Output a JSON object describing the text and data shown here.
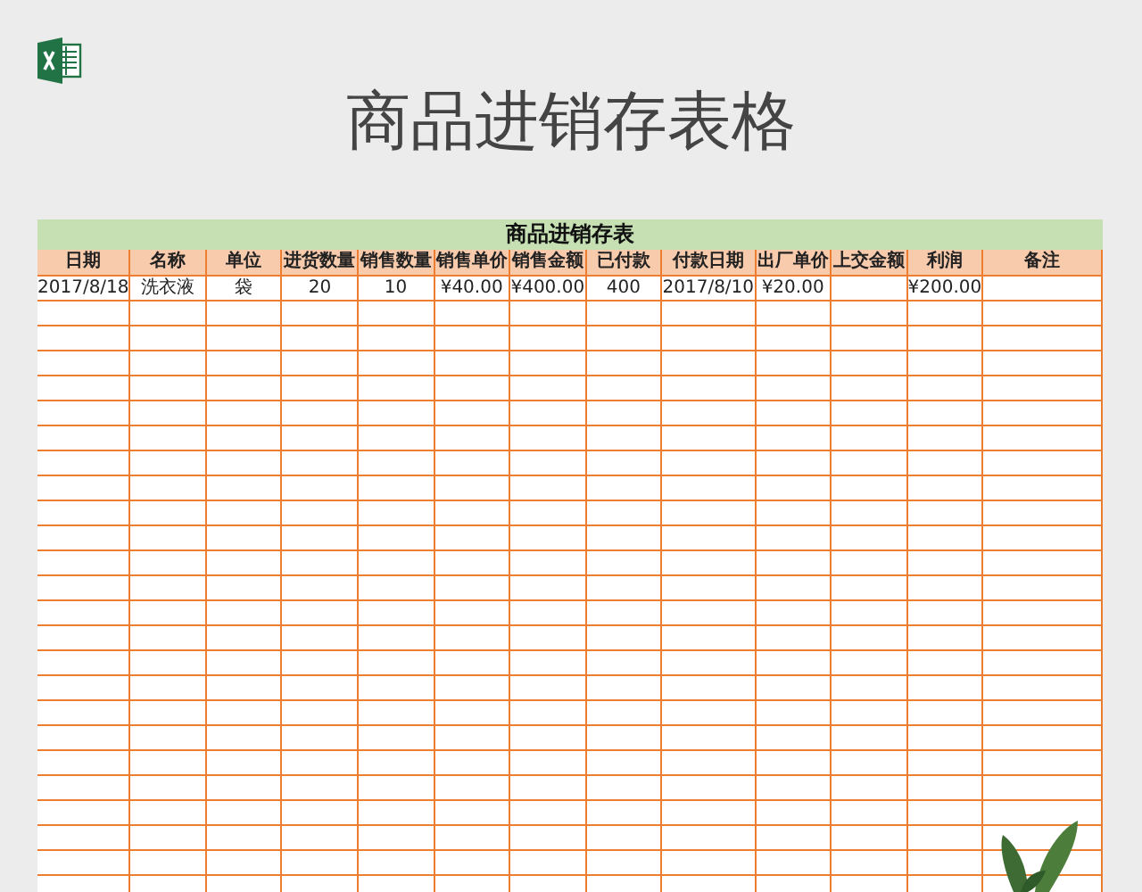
{
  "header": {
    "title": "商品进销存表格"
  },
  "sheet": {
    "title": "商品进销存表",
    "columns": [
      "日期",
      "名称",
      "单位",
      "进货数量",
      "销售数量",
      "销售单价",
      "销售金额",
      "已付款",
      "付款日期",
      "出厂单价",
      "上交金额",
      "利润",
      "备注"
    ],
    "rows": [
      {
        "cells": [
          "2017/8/18",
          "洗衣液",
          "袋",
          "20",
          "10",
          "¥40.00",
          "¥400.00",
          "400",
          "2017/8/10",
          "¥20.00",
          null,
          "¥200.00",
          null
        ]
      }
    ]
  }
}
